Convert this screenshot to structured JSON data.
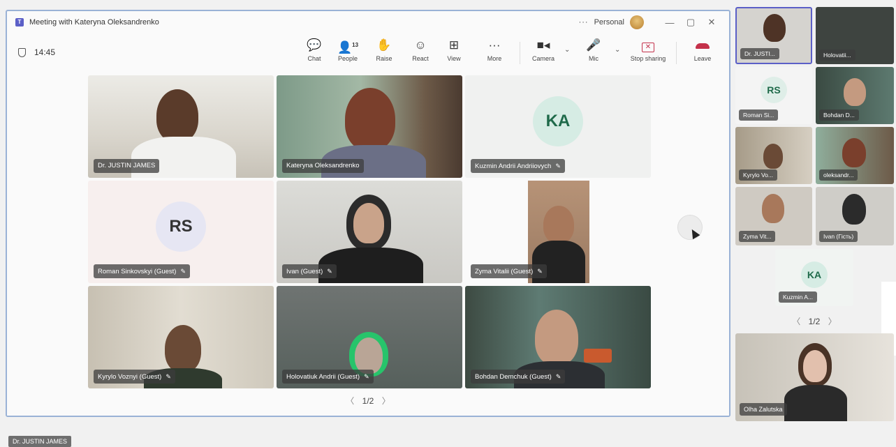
{
  "window": {
    "title": "Meeting with Kateryna Oleksandrenko",
    "more_label": "···",
    "account_label": "Personal",
    "min_label": "—",
    "max_label": "▢",
    "close_label": "✕"
  },
  "toolbar": {
    "time": "14:45",
    "chat": "Chat",
    "people": "People",
    "people_count": "13",
    "raise": "Raise",
    "react": "React",
    "view": "View",
    "more": "More",
    "camera": "Camera",
    "mic": "Mic",
    "stop_sharing": "Stop sharing",
    "leave": "Leave"
  },
  "main_tiles": [
    {
      "name": "Dr. JUSTIN JAMES",
      "muted": false
    },
    {
      "name": "Kateryna Oleksandrenko",
      "muted": false
    },
    {
      "name": "Kuzmin Andrii Andriiovych",
      "initials": "KA",
      "muted": true
    },
    {
      "name": "Roman Sinkovskyi (Guest)",
      "initials": "RS",
      "muted": true
    },
    {
      "name": "Ivan (Guest)",
      "muted": true
    },
    {
      "name": "Zyma Vitalii (Guest)",
      "muted": true
    },
    {
      "name": "Kyrylo Voznyi (Guest)",
      "muted": true
    },
    {
      "name": "Holovatiuk Andrii (Guest)",
      "muted": true
    },
    {
      "name": "Bohdan Demchuk (Guest)",
      "muted": true
    }
  ],
  "main_pager": "1/2",
  "side_tiles": [
    {
      "name": "Dr. JUSTI..."
    },
    {
      "name": "Holovatii..."
    },
    {
      "name": "Roman Si...",
      "initials": "RS"
    },
    {
      "name": "Bohdan D..."
    },
    {
      "name": "Kyrylo Vo..."
    },
    {
      "name": "oleksandr..."
    },
    {
      "name": "Zyma Vit..."
    },
    {
      "name": "Ivan (Гість)"
    },
    {
      "name": "Kuzmin A...",
      "initials": "KA"
    },
    {
      "name": "Olha Zalutska"
    }
  ],
  "side_pager": "1/2",
  "bottom_tag": "Dr. JUSTIN JAMES",
  "icons": {
    "mic": "🎙",
    "muted_mic": "🔇"
  },
  "colors": {
    "leave": "#c4314b",
    "accent": "#5b5fc7",
    "ka_avatar": "#d6ece4",
    "rs_avatar": "#e6e6f3"
  }
}
